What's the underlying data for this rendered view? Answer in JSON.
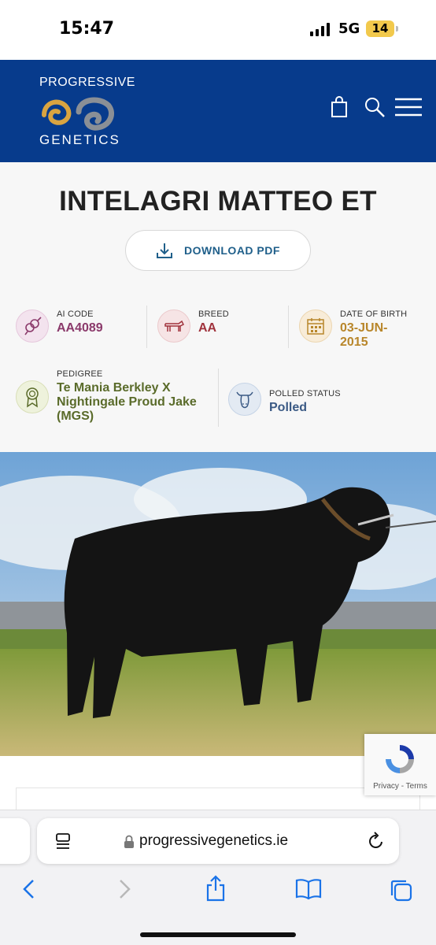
{
  "status_bar": {
    "time": "15:47",
    "network": "5G",
    "battery": "14"
  },
  "header": {
    "logo_top": "PROGRESSIVE",
    "logo_bottom": "GENETICS",
    "brand_color": "#073b8c",
    "icons": [
      "bag-icon",
      "search-icon",
      "menu-icon"
    ]
  },
  "product": {
    "title": "INTELAGRI MATTEO ET",
    "download_label": "DOWNLOAD PDF"
  },
  "info": {
    "ai_code": {
      "label": "AI CODE",
      "value": "AA4089",
      "color": "#8b3a6b"
    },
    "breed": {
      "label": "BREED",
      "value": "AA",
      "color": "#a0323c"
    },
    "dob": {
      "label": "DATE OF BIRTH",
      "value_line1": "03-JUN-",
      "value_line2": "2015",
      "color": "#b8862a"
    },
    "pedigree": {
      "label": "PEDIGREE",
      "value_line1": "Te Mania Berkley X",
      "value_line2": "Nightingale Proud Jake",
      "value_line3": "(MGS)",
      "color": "#5a6b2a"
    },
    "polled": {
      "label": "POLLED STATUS",
      "value": "Polled",
      "color": "#3b5a85"
    }
  },
  "photo": {
    "alt_subject": "bull-photo"
  },
  "recaptcha": {
    "links": "Privacy - Terms"
  },
  "browser": {
    "url": "progressivegenetics.ie",
    "toolbar": [
      "back-icon",
      "forward-icon",
      "share-icon",
      "bookmarks-icon",
      "tabs-icon"
    ]
  }
}
